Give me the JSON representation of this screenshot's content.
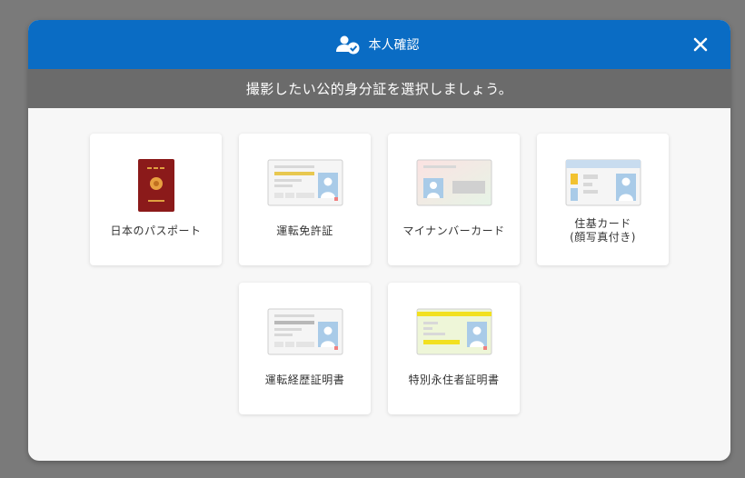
{
  "dialog": {
    "title": "本人確認",
    "instruction": "撮影したい公的身分証を選択しましょう。",
    "close_label": "✕"
  },
  "documents": [
    {
      "label": "日本のパスポート",
      "icon": "passport-icon"
    },
    {
      "label": "運転免許証",
      "icon": "drivers-license-icon"
    },
    {
      "label": "マイナンバーカード",
      "icon": "my-number-card-icon"
    },
    {
      "label_line1": "住基カード",
      "label_line2": "(顔写真付き)",
      "icon": "resident-card-icon"
    },
    {
      "label": "運転経歴証明書",
      "icon": "driving-history-certificate-icon"
    },
    {
      "label": "特別永住者証明書",
      "icon": "special-permanent-resident-certificate-icon"
    }
  ],
  "colors": {
    "header": "#0a6cc4",
    "subheader": "#6b6b6b",
    "overlay": "#7a7a7a",
    "passport": "#8b1a1a"
  }
}
